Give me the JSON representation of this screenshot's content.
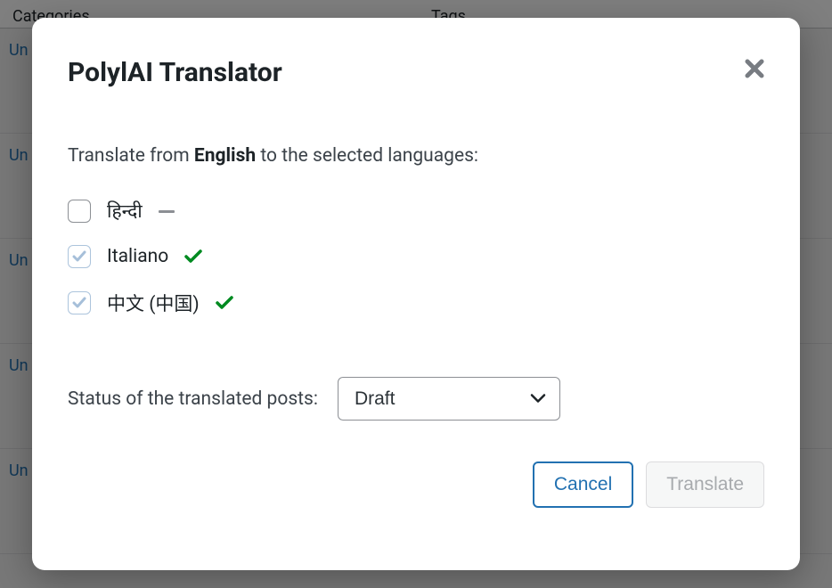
{
  "background": {
    "header_categories": "Categories",
    "header_tags": "Tags",
    "row_link": "Un"
  },
  "modal": {
    "title": "PolylAI Translator",
    "instruction_prefix": "Translate from ",
    "instruction_language": "English",
    "instruction_suffix": " to the selected languages:",
    "languages": [
      {
        "label": "हिन्दी",
        "checked": false,
        "status": "pending"
      },
      {
        "label": "Italiano",
        "checked": true,
        "status": "done"
      },
      {
        "label": "中文 (中国)",
        "checked": true,
        "status": "done"
      }
    ],
    "status_label": "Status of the translated posts:",
    "status_select": {
      "selected": "Draft"
    },
    "buttons": {
      "cancel": "Cancel",
      "translate": "Translate"
    }
  }
}
